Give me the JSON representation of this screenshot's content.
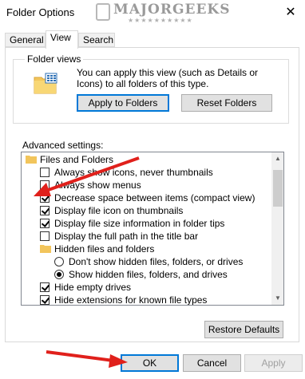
{
  "window": {
    "title": "Folder Options"
  },
  "watermark": {
    "text": "MAJORGEEKS",
    "stars": "★★★★★★★★★★"
  },
  "tabs": [
    {
      "label": "General"
    },
    {
      "label": "View",
      "active": true
    },
    {
      "label": "Search"
    }
  ],
  "folder_views": {
    "legend": "Folder views",
    "description": "You can apply this view (such as Details or Icons) to all folders of this type.",
    "apply_label": "Apply to Folders",
    "reset_label": "Reset Folders"
  },
  "advanced": {
    "label": "Advanced settings:",
    "items": [
      {
        "kind": "folder",
        "label": "Files and Folders"
      },
      {
        "kind": "checkbox",
        "checked": false,
        "label": "Always show icons, never thumbnails"
      },
      {
        "kind": "checkbox",
        "checked": false,
        "label": "Always show menus"
      },
      {
        "kind": "checkbox",
        "checked": true,
        "label": "Decrease space between items (compact view)"
      },
      {
        "kind": "checkbox",
        "checked": true,
        "label": "Display file icon on thumbnails"
      },
      {
        "kind": "checkbox",
        "checked": true,
        "label": "Display file size information in folder tips"
      },
      {
        "kind": "checkbox",
        "checked": false,
        "label": "Display the full path in the title bar"
      },
      {
        "kind": "folder",
        "label": "Hidden files and folders"
      },
      {
        "kind": "radio",
        "checked": false,
        "label": "Don't show hidden files, folders, or drives"
      },
      {
        "kind": "radio",
        "checked": true,
        "label": "Show hidden files, folders, and drives"
      },
      {
        "kind": "checkbox",
        "checked": true,
        "label": "Hide empty drives"
      },
      {
        "kind": "checkbox",
        "checked": true,
        "label": "Hide extensions for known file types"
      }
    ]
  },
  "buttons": {
    "restore": "Restore Defaults",
    "ok": "OK",
    "cancel": "Cancel",
    "apply": "Apply"
  },
  "colors": {
    "accent": "#0078d7",
    "annotation_arrow": "#e0201b",
    "folder": "#f2c55c"
  }
}
